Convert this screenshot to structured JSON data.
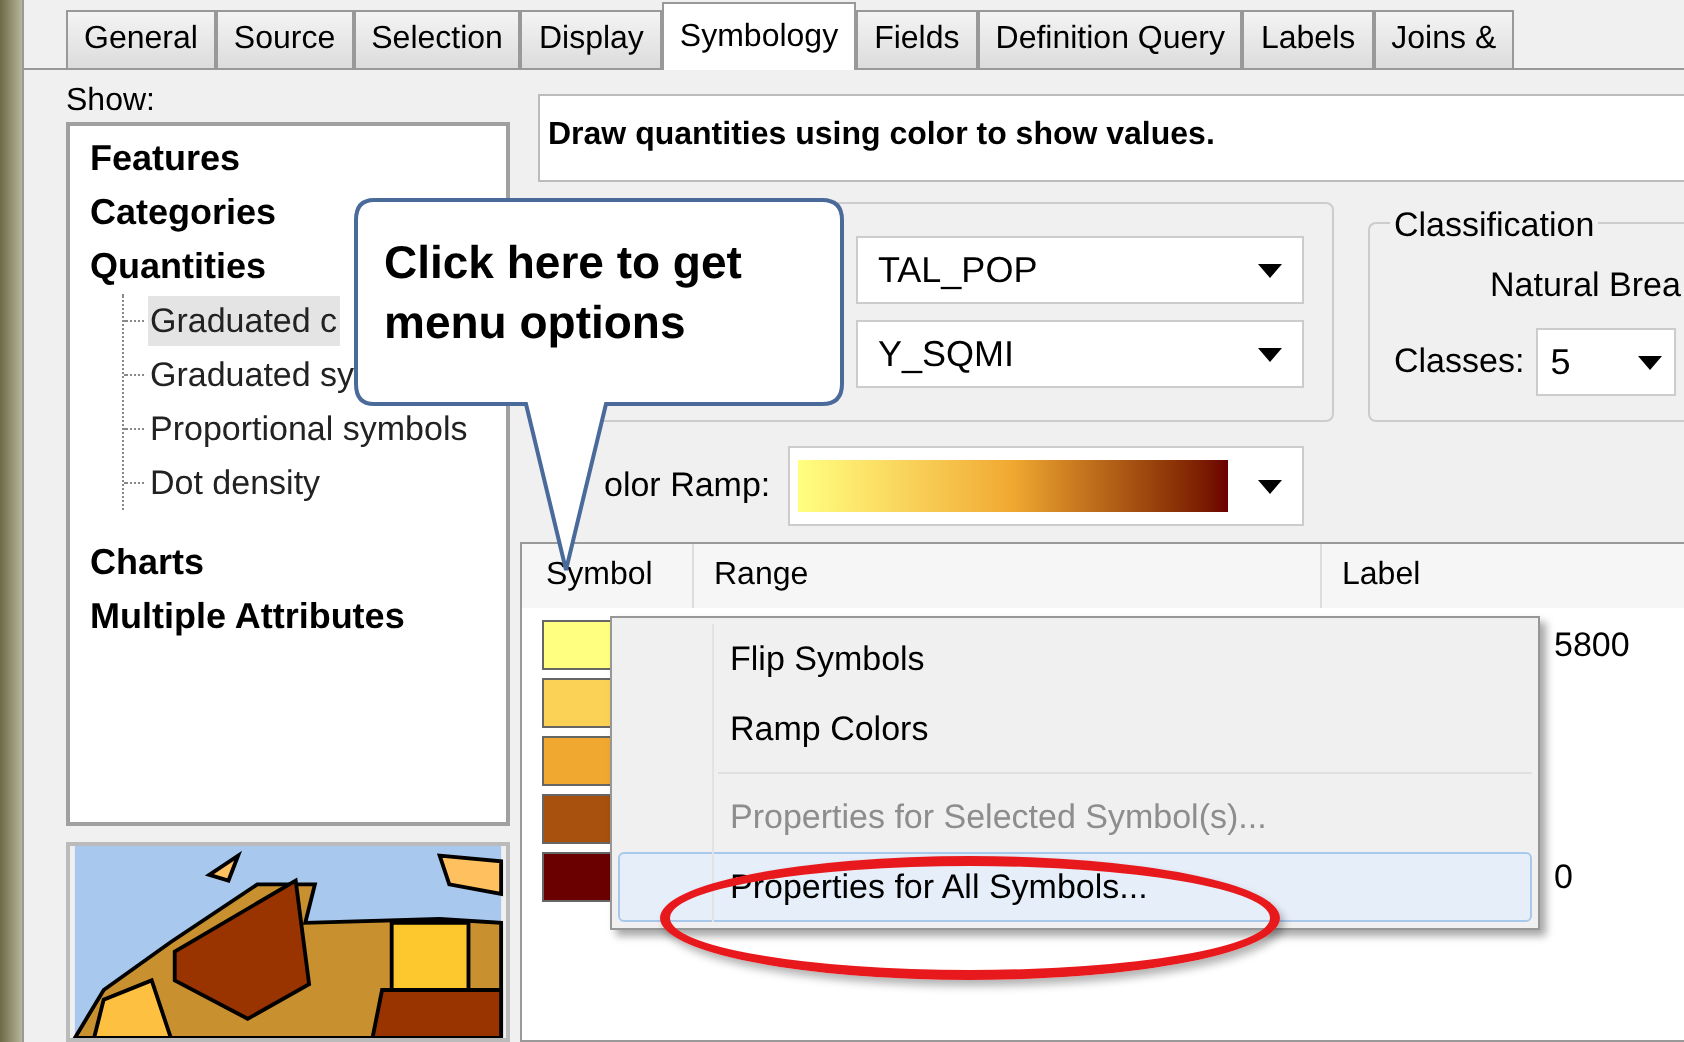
{
  "tabs": [
    {
      "label": "General",
      "selected": false
    },
    {
      "label": "Source",
      "selected": false
    },
    {
      "label": "Selection",
      "selected": false
    },
    {
      "label": "Display",
      "selected": false
    },
    {
      "label": "Symbology",
      "selected": true
    },
    {
      "label": "Fields",
      "selected": false
    },
    {
      "label": "Definition Query",
      "selected": false
    },
    {
      "label": "Labels",
      "selected": false
    },
    {
      "label": "Joins &",
      "selected": false
    }
  ],
  "show": {
    "label": "Show:",
    "items": [
      {
        "label": "Features",
        "selected": false
      },
      {
        "label": "Categories",
        "selected": false
      },
      {
        "label": "Quantities",
        "selected": false,
        "children": [
          {
            "label": "Graduated c",
            "selected": true
          },
          {
            "label": "Graduated sy",
            "selected": false
          },
          {
            "label": "Proportional symbols",
            "selected": false
          },
          {
            "label": "Dot density",
            "selected": false
          }
        ]
      },
      {
        "label": "Charts",
        "selected": false
      },
      {
        "label": "Multiple Attributes",
        "selected": false
      }
    ]
  },
  "description": "Draw quantities using color to show values.",
  "fields": {
    "value": "TAL_POP",
    "normalization": "Y_SQMI"
  },
  "classification": {
    "title": "Classification",
    "method": "Natural Brea",
    "classes_label": "Classes:",
    "classes": "5"
  },
  "color_ramp": {
    "label": "olor Ramp:"
  },
  "table": {
    "columns": [
      "Symbol",
      "Range",
      "Label"
    ],
    "rows": [
      {
        "color": "#ffff80",
        "label": "5800"
      },
      {
        "color": "#fcd256"
      },
      {
        "color": "#f0a830"
      },
      {
        "color": "#a8500e"
      },
      {
        "color": "#6b0000",
        "label": "0"
      }
    ]
  },
  "context_menu": [
    {
      "kind": "item",
      "label": "Flip Symbols",
      "disabled": false,
      "selected": false
    },
    {
      "kind": "item",
      "label": "Ramp Colors",
      "disabled": false,
      "selected": false
    },
    {
      "kind": "separator"
    },
    {
      "kind": "item",
      "label": "Properties for Selected Symbol(s)...",
      "disabled": true,
      "selected": false
    },
    {
      "kind": "item",
      "label": "Properties for All Symbols...",
      "disabled": false,
      "selected": true
    }
  ],
  "callout": {
    "lines": [
      "Click here to get",
      "menu options"
    ]
  }
}
